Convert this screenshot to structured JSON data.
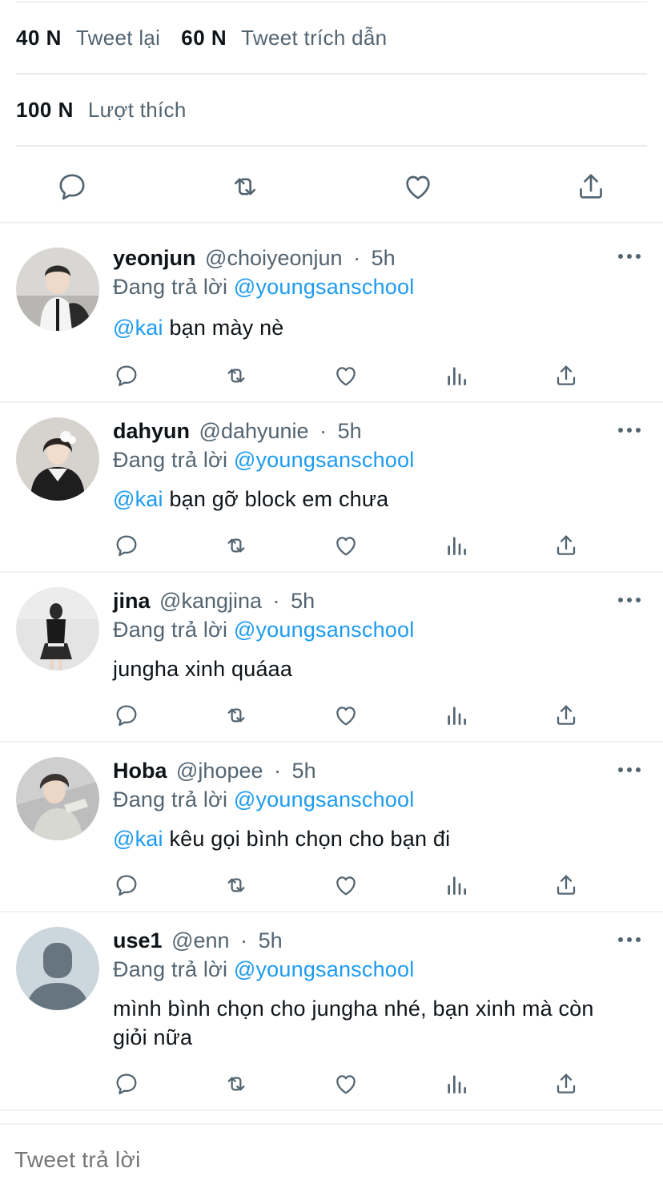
{
  "stats": {
    "retweets_num": "40 N",
    "retweets_label": "Tweet lại",
    "quotes_num": "60 N",
    "quotes_label": "Tweet trích dẫn",
    "likes_num": "100 N",
    "likes_label": "Lượt thích"
  },
  "icons": {
    "reply": "reply-icon",
    "retweet": "retweet-icon",
    "like": "heart-icon",
    "analytics": "analytics-icon",
    "share": "share-icon",
    "more": "more-icon"
  },
  "colors": {
    "link": "#1d9bf0",
    "secondary_text": "#536471",
    "primary_text": "#0f1419",
    "divider": "#eff1f3"
  },
  "replies": [
    {
      "name": "yeonjun",
      "handle": "@choiyeonjun",
      "dot": "·",
      "time": "5h",
      "replying_prefix": "Đang trả lời",
      "replying_to": "@youngsanschool",
      "mention": "@kai",
      "text": "bạn mày nè"
    },
    {
      "name": "dahyun",
      "handle": "@dahyunie",
      "dot": "·",
      "time": "5h",
      "replying_prefix": "Đang trả lời",
      "replying_to": "@youngsanschool",
      "mention": "@kai",
      "text": "bạn gỡ block em chưa"
    },
    {
      "name": "jina",
      "handle": "@kangjina",
      "dot": "·",
      "time": "5h",
      "replying_prefix": "Đang trả lời",
      "replying_to": "@youngsanschool",
      "mention": "",
      "text": "jungha xinh quáaa"
    },
    {
      "name": "Hoba",
      "handle": "@jhopee",
      "dot": "·",
      "time": "5h",
      "replying_prefix": "Đang trả lời",
      "replying_to": "@youngsanschool",
      "mention": "@kai",
      "text": "kêu gọi bình chọn cho bạn đi"
    },
    {
      "name": "use1",
      "handle": "@enn",
      "dot": "·",
      "time": "5h",
      "replying_prefix": "Đang trả lời",
      "replying_to": "@youngsanschool",
      "mention": "",
      "text": "mình bình chọn cho jungha nhé, bạn xinh mà còn giỏi nữa"
    }
  ],
  "compose": {
    "placeholder": "Tweet trả lời"
  }
}
